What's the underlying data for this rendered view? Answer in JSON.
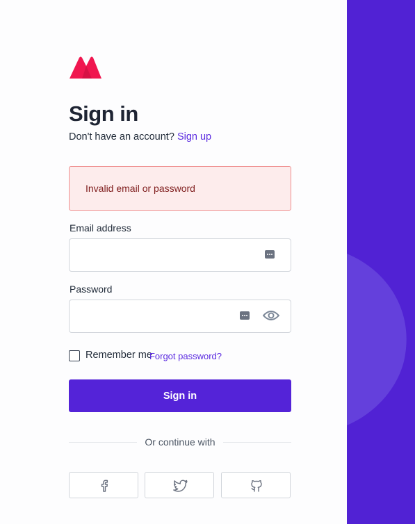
{
  "page": {
    "title": "Sign in",
    "signup_prompt": "Don't have an account?",
    "signup_link": "Sign up"
  },
  "alert": {
    "message": "Invalid email or password"
  },
  "form": {
    "email_label": "Email address",
    "email_value": "",
    "password_label": "Password",
    "password_value": "",
    "remember_label": "Remember me",
    "remember_checked": false,
    "forgot_link": "Forgot password?",
    "submit_label": "Sign in"
  },
  "social": {
    "divider_text": "Or continue with",
    "providers": [
      "facebook-icon",
      "twitter-icon",
      "github-icon"
    ]
  },
  "colors": {
    "brand": "#5423d8",
    "logo": "#f0164f",
    "error_bg": "#fdecec",
    "error_border": "#ef8e8e",
    "error_text": "#7f1d1d"
  }
}
